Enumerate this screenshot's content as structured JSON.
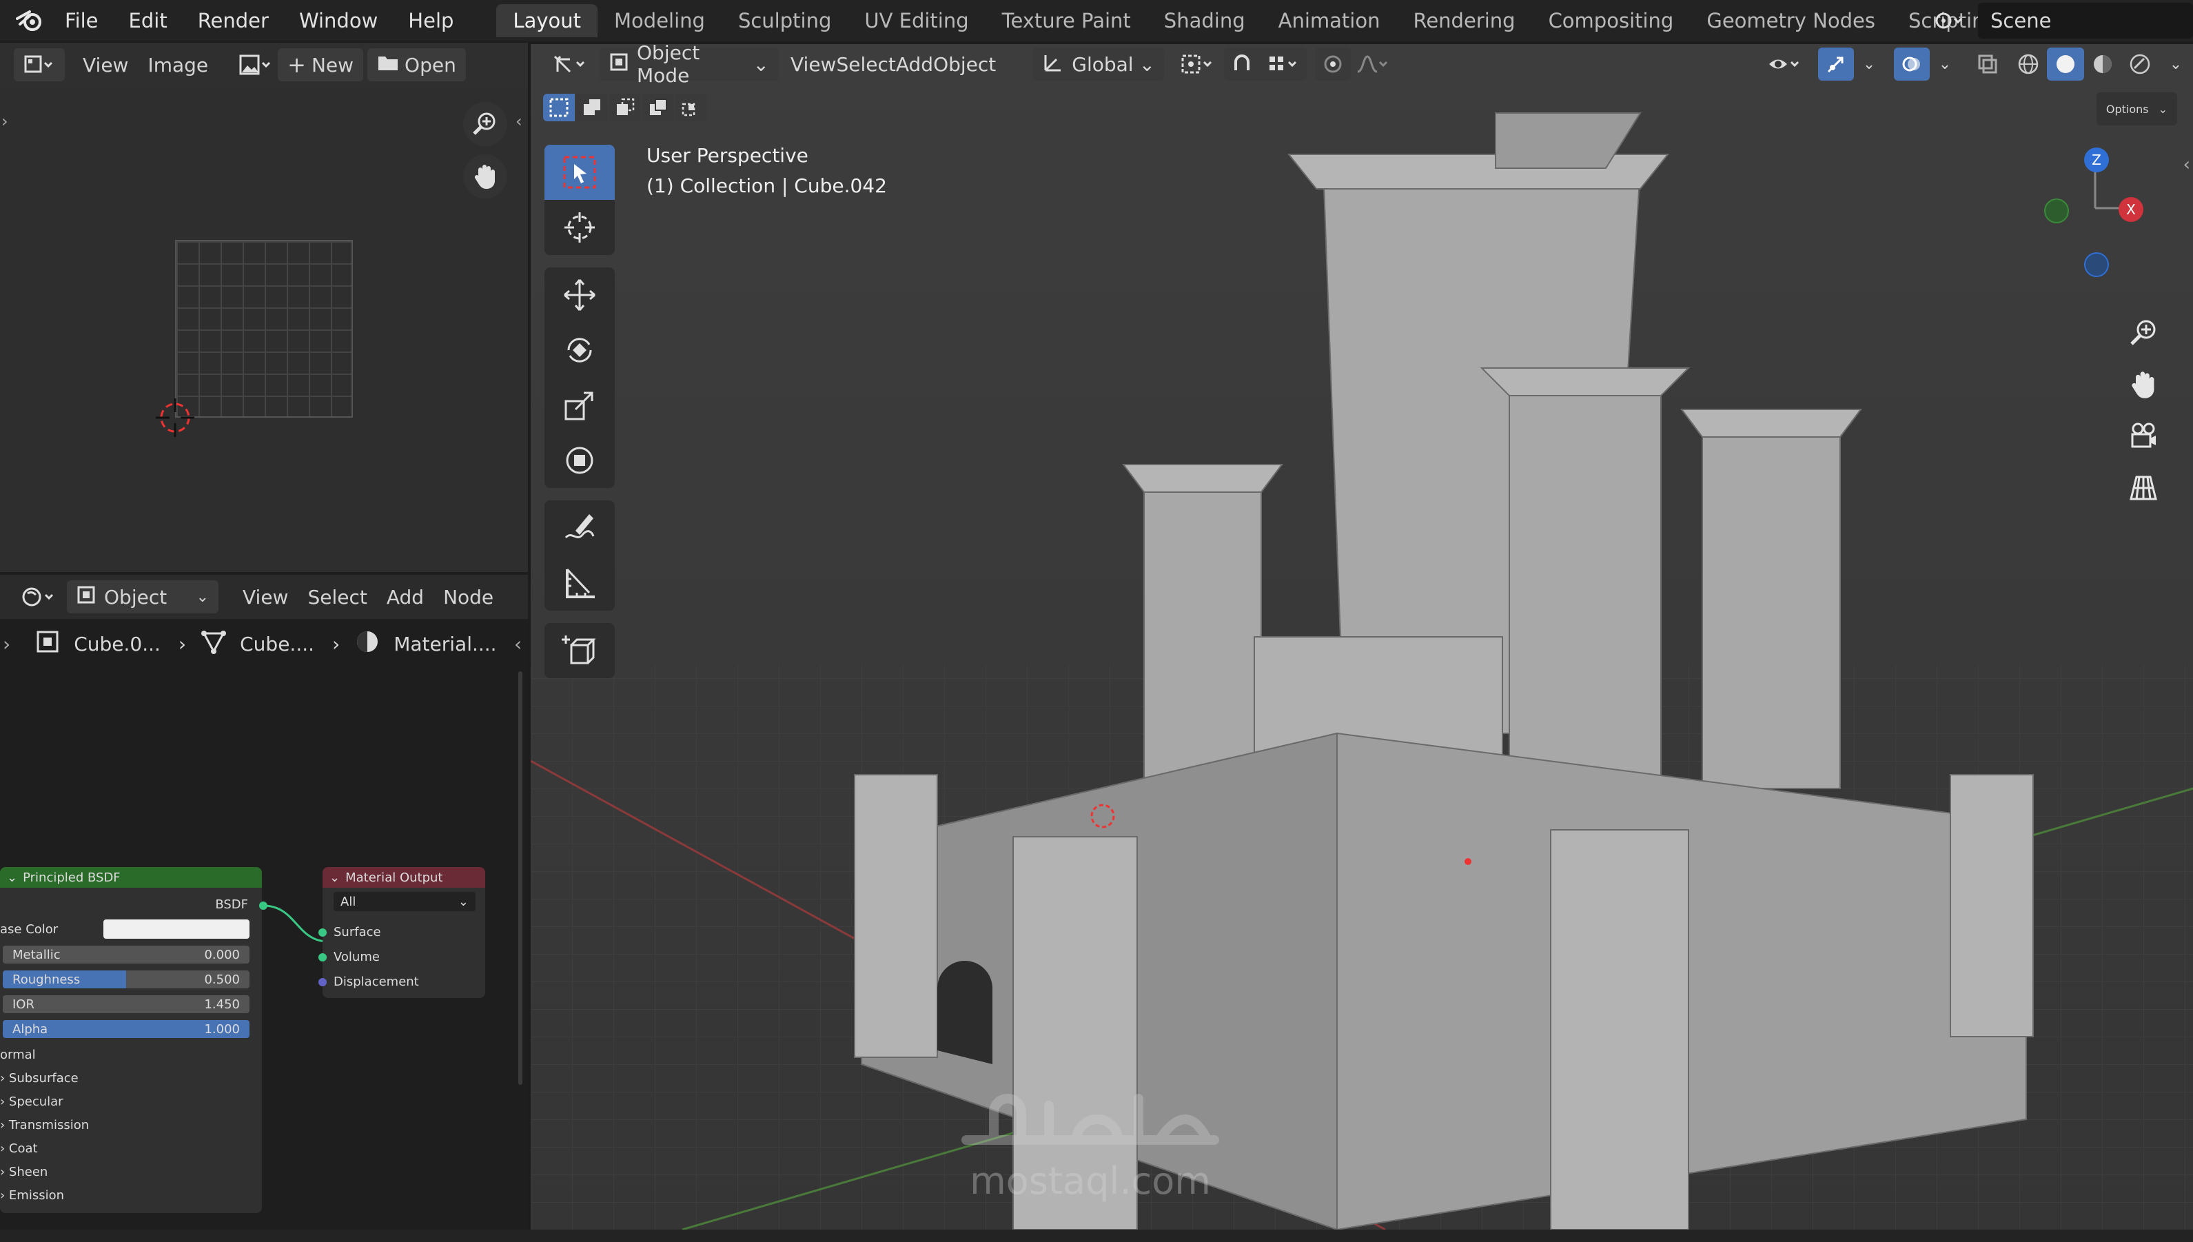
{
  "menu": {
    "file": "File",
    "edit": "Edit",
    "render": "Render",
    "window": "Window",
    "help": "Help"
  },
  "workspaces": [
    "Layout",
    "Modeling",
    "Sculpting",
    "UV Editing",
    "Texture Paint",
    "Shading",
    "Animation",
    "Rendering",
    "Compositing",
    "Geometry Nodes",
    "Scripting"
  ],
  "scene": "Scene",
  "image_editor": {
    "view": "View",
    "image": "Image",
    "new": "New",
    "open": "Open"
  },
  "node_editor": {
    "object_type": "Object",
    "view": "View",
    "select": "Select",
    "add": "Add",
    "node": "Node",
    "breadcrumb": [
      "Cube.0...",
      "Cube....",
      "Material...."
    ]
  },
  "bsdf": {
    "title": "Principled BSDF",
    "output": "BSDF",
    "base_color_label": "ase Color",
    "base_color": "#f0f0f0",
    "fields": [
      {
        "label": "Metallic",
        "value": "0.000",
        "fill": 0
      },
      {
        "label": "Roughness",
        "value": "0.500",
        "fill": 0.5
      },
      {
        "label": "IOR",
        "value": "1.450",
        "fill": 0
      },
      {
        "label": "Alpha",
        "value": "1.000",
        "fill": 1
      }
    ],
    "normal": "ormal",
    "sections": [
      "Subsurface",
      "Specular",
      "Transmission",
      "Coat",
      "Sheen",
      "Emission"
    ]
  },
  "material_output": {
    "title": "Material Output",
    "target": "All",
    "inputs": [
      "Surface",
      "Volume",
      "Displacement"
    ]
  },
  "viewport": {
    "mode": "Object Mode",
    "view": "View",
    "select": "Select",
    "add": "Add",
    "object": "Object",
    "orientation": "Global",
    "options": "Options",
    "info_line1": "User Perspective",
    "info_line2": "(1) Collection | Cube.042"
  },
  "gizmo": {
    "z": "Z",
    "x": "X"
  },
  "watermark": {
    "text": "mostaql.com"
  },
  "colors": {
    "accent": "#4772b3",
    "header_green": "#2e7d32",
    "header_red": "#6a2a36",
    "x_axis": "#d0333b",
    "z_axis": "#2f6fd6",
    "y_axis": "#3a8a3a"
  }
}
